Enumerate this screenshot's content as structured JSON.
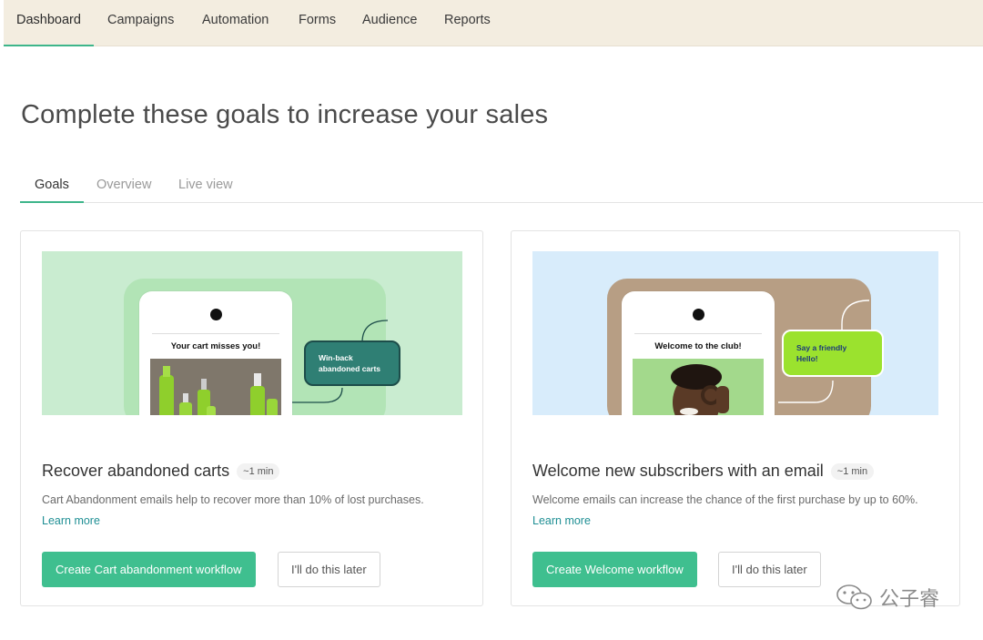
{
  "nav": {
    "items": [
      {
        "label": "Dashboard"
      },
      {
        "label": "Campaigns"
      },
      {
        "label": "Automation"
      },
      {
        "label": "Forms"
      },
      {
        "label": "Audience"
      },
      {
        "label": "Reports"
      }
    ],
    "active": "Dashboard"
  },
  "page": {
    "title": "Complete these goals to increase your sales"
  },
  "tabs": [
    {
      "label": "Goals"
    },
    {
      "label": "Overview"
    },
    {
      "label": "Live view"
    }
  ],
  "cards": [
    {
      "illustration": {
        "phone_title": "Your cart misses you!",
        "pill": "Win-back abandoned carts"
      },
      "title": "Recover abandoned carts",
      "time": "~1 min",
      "description": "Cart Abandonment emails help to recover more than 10% of lost purchases.",
      "learn_more": "Learn more",
      "primary_button": "Create Cart abandonment workflow",
      "secondary_button": "I'll do this later"
    },
    {
      "illustration": {
        "phone_title": "Welcome to the club!",
        "pill": "Say a friendly Hello!"
      },
      "title": "Welcome new subscribers with an email",
      "time": "~1 min",
      "description": "Welcome emails can increase the chance of the first purchase by up to 60%.",
      "learn_more": "Learn more",
      "primary_button": "Create Welcome workflow",
      "secondary_button": "I'll do this later"
    }
  ],
  "watermark": {
    "text": "公子睿"
  },
  "colors": {
    "accent": "#3fbf8f",
    "nav_bg": "#f3ede0",
    "link": "#1f8f94"
  }
}
